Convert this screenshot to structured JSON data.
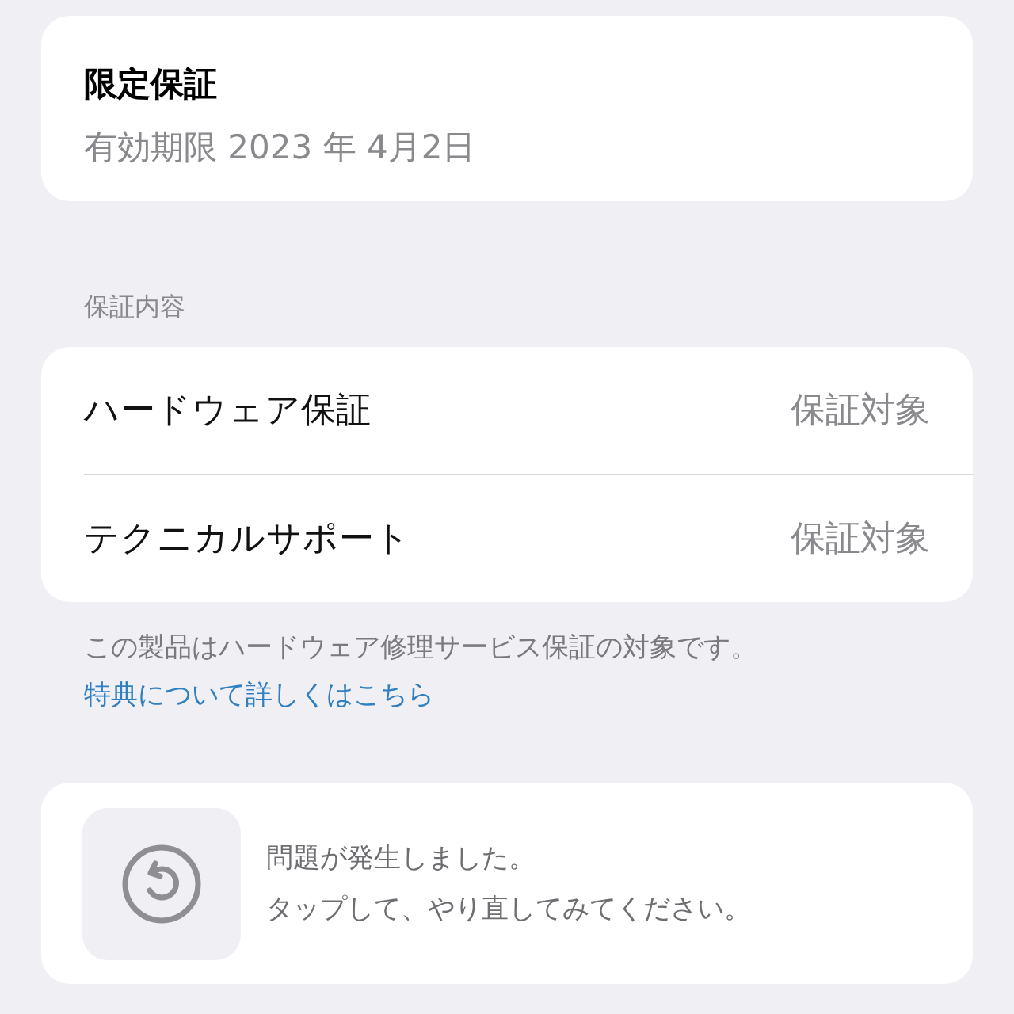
{
  "warranty": {
    "title": "限定保証",
    "expiry": "有効期限 2023 年 4月2日"
  },
  "coverage": {
    "header": "保証内容",
    "rows": [
      {
        "label": "ハードウェア保証",
        "value": "保証対象"
      },
      {
        "label": "テクニカルサポート",
        "value": "保証対象"
      }
    ]
  },
  "note": {
    "text": "この製品はハードウェア修理サービス保証の対象です。",
    "link": "特典について詳しくはこちら"
  },
  "error": {
    "lines": [
      "問題が発生しました。",
      "タップして、やり直してみてください。"
    ]
  }
}
